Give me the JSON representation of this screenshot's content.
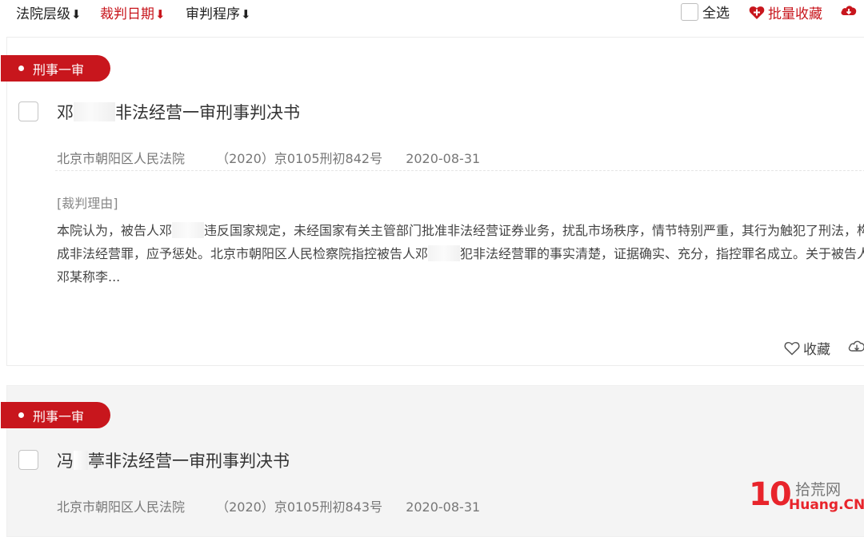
{
  "sort_bar": {
    "court_level": "法院层级",
    "judgment_date": "裁判日期",
    "procedure": "审判程序",
    "select_all": "全选",
    "batch_collect": "批量收藏",
    "arrow": "⬇"
  },
  "results": [
    {
      "tag": "刑事一审",
      "title_prefix": "邓",
      "title_suffix": "非法经营一审刑事判决书",
      "court": "北京市朝阳区人民法院",
      "case_no": "（2020）京0105刑初842号",
      "date": "2020-08-31",
      "reason_label": "[裁判理由]",
      "summary_1": "本院认为，被告人邓",
      "summary_2": "违反国家规定，未经国家有关主管部门批准非法经营证券业务，扰乱市场秩序，情节特别严重，其行为触犯了刑法，构成非法经营罪，应予惩处。北京市朝阳区人民检察院指控被告人邓",
      "summary_3": "犯非法经营罪的事实清楚，证据确实、充分，指控罪名成立。关于被告人邓某称李...",
      "collect_label": "收藏"
    },
    {
      "tag": "刑事一审",
      "title_prefix": "冯",
      "title_suffix": "葶非法经营一审刑事判决书",
      "court": "北京市朝阳区人民法院",
      "case_no": "（2020）京0105刑初843号",
      "date": "2020-08-31"
    }
  ],
  "watermark": {
    "number": "10",
    "cn": "拾荒网",
    "en": "Huang.CN"
  },
  "colors": {
    "accent": "#c8161d"
  },
  "icons": {
    "heart_plus": "heart-plus-icon",
    "heart": "heart-outline-icon",
    "cloud_download": "cloud-download-icon"
  }
}
